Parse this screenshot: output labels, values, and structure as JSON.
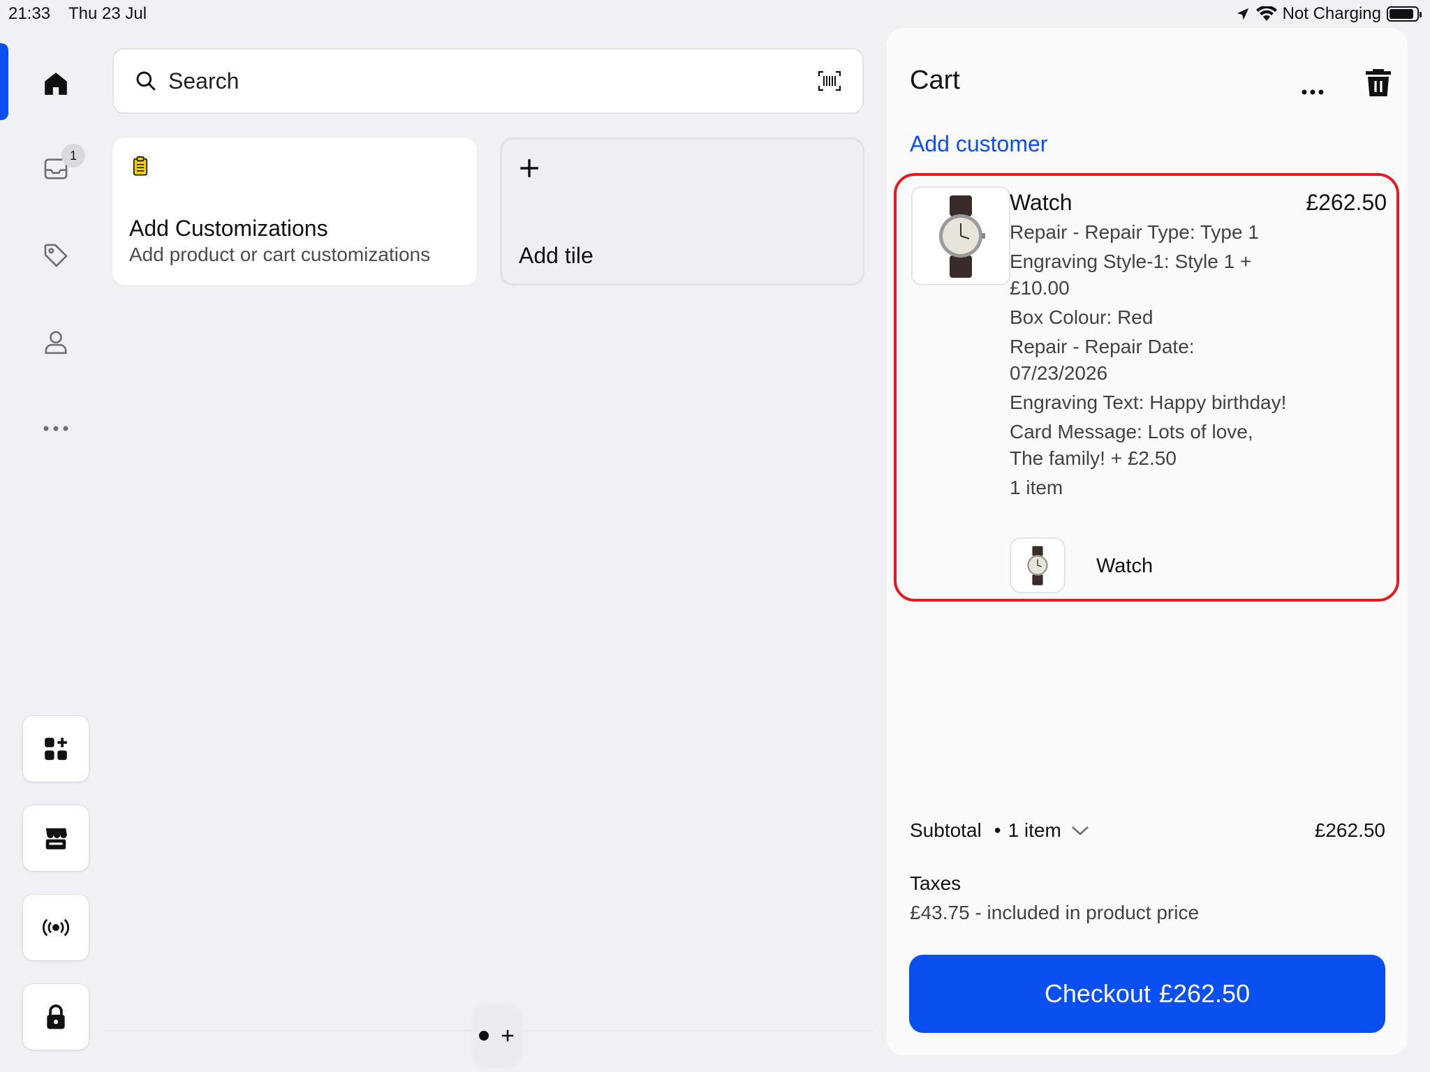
{
  "status_bar": {
    "time": "21:33",
    "date": "Thu 23 Jul",
    "battery_label": "Not Charging",
    "icons": [
      "location-icon",
      "wifi-icon",
      "battery-icon"
    ]
  },
  "rail": {
    "items": [
      {
        "name": "home",
        "icon": "home-icon",
        "active": true
      },
      {
        "name": "orders",
        "icon": "inbox-icon",
        "badge": "1"
      },
      {
        "name": "products",
        "icon": "tag-icon"
      },
      {
        "name": "customers",
        "icon": "person-icon"
      },
      {
        "name": "more",
        "icon": "ellipsis-icon"
      }
    ],
    "buttons": [
      "add-tile-grid-icon",
      "store-icon",
      "broadcast-icon",
      "lock-icon"
    ]
  },
  "search": {
    "placeholder": "Search",
    "scan_icon": "barcode-scan-icon"
  },
  "tiles": {
    "custom": {
      "title": "Add Customizations",
      "subtitle": "Add product or cart customizations",
      "icon": "clipboard-icon"
    },
    "add": {
      "title": "Add tile",
      "icon": "plus-icon"
    }
  },
  "cart": {
    "title": "Cart",
    "add_customer": "Add customer",
    "line_item": {
      "name": "Watch",
      "price": "£262.50",
      "properties": [
        "Repair - Repair Type: Type 1",
        "Engraving Style-1: Style 1 + £10.00",
        "Box Colour: Red",
        "Repair - Repair Date: 07/23/2026",
        "Engraving Text: Happy birthday!",
        "Card Message: Lots of love, The family! + £2.50",
        "1 item"
      ],
      "bundle_item_name": "Watch"
    },
    "subtotal": {
      "label": "Subtotal",
      "count": "1 item",
      "value": "£262.50"
    },
    "taxes": {
      "label": "Taxes",
      "detail": "£43.75 - included in product price"
    },
    "checkout": {
      "label": "Checkout",
      "amount": "£262.50"
    }
  },
  "colors": {
    "accent": "#0a4ff0",
    "highlight": "#e41b23",
    "background": "#f0f1f2"
  }
}
